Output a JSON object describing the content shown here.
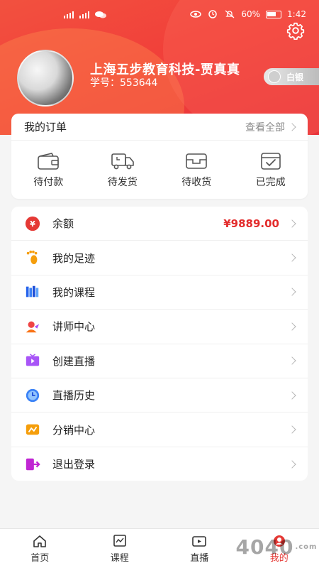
{
  "status_bar": {
    "battery": "60%",
    "time": "1:42"
  },
  "profile": {
    "name": "上海五步教育科技-贾真真",
    "student_id": "学号：553644",
    "level": "白银"
  },
  "orders": {
    "title": "我的订单",
    "view_all": "查看全部",
    "items": [
      {
        "label": "待付款",
        "icon": "wallet-icon"
      },
      {
        "label": "待发货",
        "icon": "truck-icon"
      },
      {
        "label": "待收货",
        "icon": "package-icon"
      },
      {
        "label": "已完成",
        "icon": "completed-icon"
      }
    ]
  },
  "menu": {
    "items": [
      {
        "label": "余额",
        "value": "¥9889.00",
        "icon": "balance-icon",
        "color": "#e53935"
      },
      {
        "label": "我的足迹",
        "value": "",
        "icon": "footprint-icon",
        "color": "#f59e0b"
      },
      {
        "label": "我的课程",
        "value": "",
        "icon": "books-icon",
        "color": "#2563eb"
      },
      {
        "label": "讲师中心",
        "value": "",
        "icon": "teacher-icon",
        "color": "#ef4444"
      },
      {
        "label": "创建直播",
        "value": "",
        "icon": "tv-icon",
        "color": "#a855f7"
      },
      {
        "label": "直播历史",
        "value": "",
        "icon": "clock-icon",
        "color": "#3b82f6"
      },
      {
        "label": "分销中心",
        "value": "",
        "icon": "distribution-icon",
        "color": "#f59e0b"
      },
      {
        "label": "退出登录",
        "value": "",
        "icon": "logout-icon",
        "color": "#c026d3"
      }
    ]
  },
  "bottom_nav": {
    "items": [
      {
        "label": "首页",
        "icon": "home-icon",
        "active": false
      },
      {
        "label": "课程",
        "icon": "course-icon",
        "active": false
      },
      {
        "label": "直播",
        "icon": "live-icon",
        "active": false
      },
      {
        "label": "我的",
        "icon": "profile-icon",
        "active": true
      }
    ]
  },
  "watermark": {
    "text": "4040",
    "suffix": ".com"
  }
}
